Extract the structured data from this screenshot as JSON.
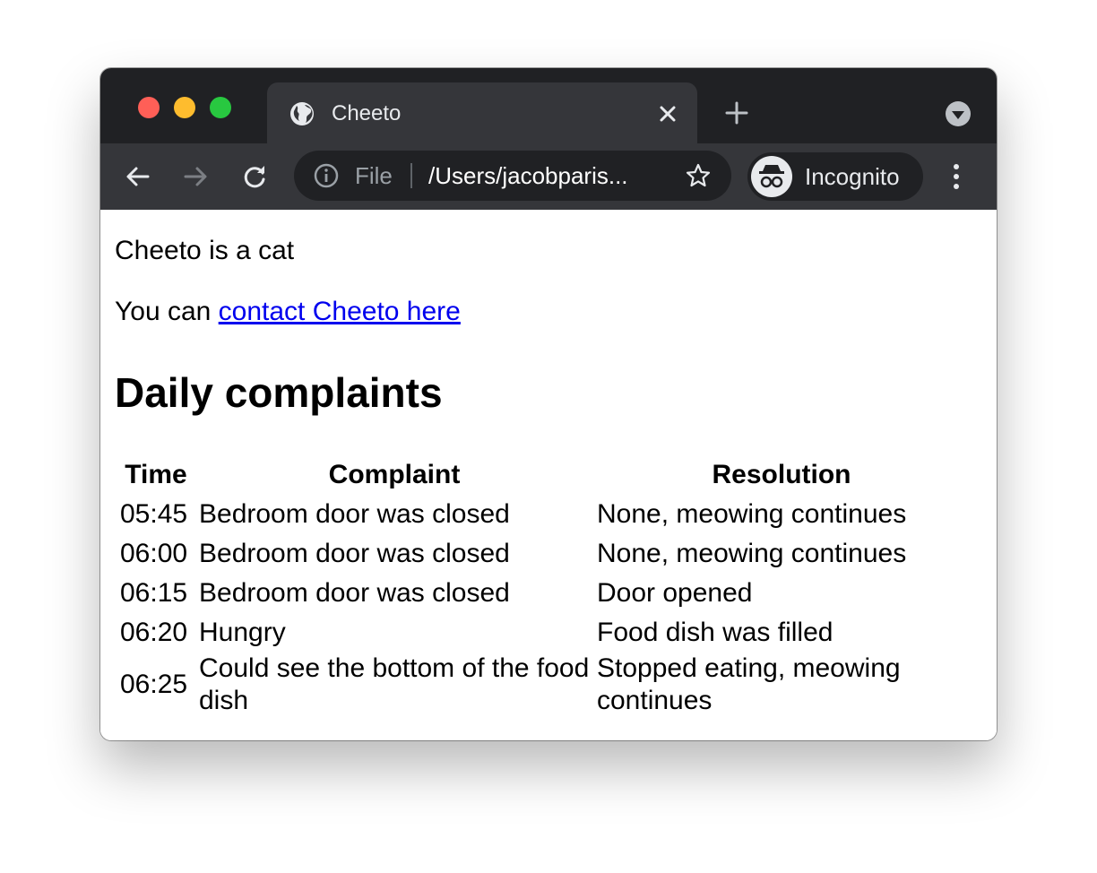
{
  "browser": {
    "tab_title": "Cheeto",
    "scheme_label": "File",
    "url": "/Users/jacobparis...",
    "profile_label": "Incognito"
  },
  "page": {
    "intro": "Cheeto is a cat",
    "contact_prefix": "You can ",
    "contact_link": "contact Cheeto here",
    "heading": "Daily complaints",
    "table": {
      "headers": [
        "Time",
        "Complaint",
        "Resolution"
      ],
      "rows": [
        [
          "05:45",
          "Bedroom door was closed",
          "None, meowing continues"
        ],
        [
          "06:00",
          "Bedroom door was closed",
          "None, meowing continues"
        ],
        [
          "06:15",
          "Bedroom door was closed",
          "Door opened"
        ],
        [
          "06:20",
          "Hungry",
          "Food dish was filled"
        ],
        [
          "06:25",
          "Could see the bottom of the food dish",
          "Stopped eating, meowing continues"
        ]
      ]
    }
  },
  "colors": {
    "titlebar": "#202124",
    "toolbar": "#35363a",
    "link": "#0000ee"
  }
}
